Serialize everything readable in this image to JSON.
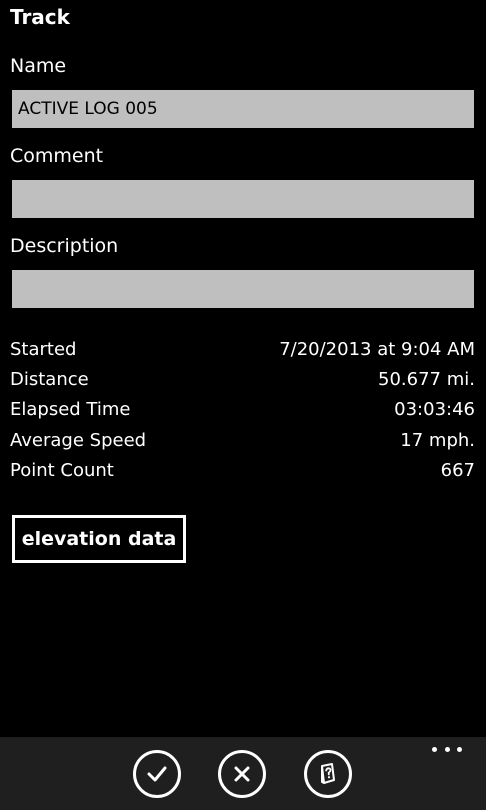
{
  "page": {
    "title": "Track"
  },
  "fields": {
    "name_label": "Name",
    "name_value": "ACTIVE LOG 005",
    "comment_label": "Comment",
    "comment_value": "",
    "description_label": "Description",
    "description_value": ""
  },
  "stats": [
    {
      "label": "Started",
      "value": "7/20/2013 at 9:04 AM"
    },
    {
      "label": "Distance",
      "value": "50.677 mi."
    },
    {
      "label": "Elapsed Time",
      "value": "03:03:46"
    },
    {
      "label": "Average Speed",
      "value": "17 mph."
    },
    {
      "label": "Point Count",
      "value": "667"
    }
  ],
  "buttons": {
    "elevation_label": "elevation data"
  },
  "app_bar": {
    "buttons": [
      {
        "icon": "check-icon"
      },
      {
        "icon": "close-icon"
      },
      {
        "icon": "help-book-icon"
      }
    ],
    "more_icon": "more-dots-icon"
  },
  "colors": {
    "background": "#000000",
    "field_background": "#bfbfbf",
    "app_bar_background": "#1f1f1f",
    "text": "#ffffff"
  }
}
